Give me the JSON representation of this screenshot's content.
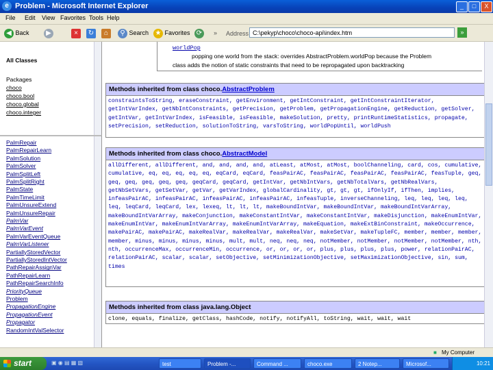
{
  "window": {
    "title": "Problem - Microsoft Internet Explorer",
    "controls": [
      "_",
      "□",
      "X"
    ]
  },
  "menu": [
    "File",
    "Edit",
    "View",
    "Favorites",
    "Tools",
    "Help"
  ],
  "toolbar": {
    "back_label": "Back",
    "search_label": "Search",
    "favorites_label": "Favorites",
    "address_label": "Address",
    "address_value": "C:\\pekyp\\choco\\choco-api\\index.htm",
    "go_label": "»"
  },
  "left_top": {
    "all_classes": "All Classes",
    "packages_label": "Packages",
    "packages": [
      "choco",
      "choco.bool",
      "choco.global",
      "choco.integer"
    ]
  },
  "left_bottom": {
    "classes": [
      {
        "name": "PalmRepair",
        "italic": false
      },
      {
        "name": "PalmRepairLearn",
        "italic": false
      },
      {
        "name": "PalmSolution",
        "italic": false
      },
      {
        "name": "PalmSolver",
        "italic": false
      },
      {
        "name": "PalmSplitLeft",
        "italic": false
      },
      {
        "name": "PalmSplitRight",
        "italic": false
      },
      {
        "name": "PalmState",
        "italic": false
      },
      {
        "name": "PalmTimeLimit",
        "italic": false
      },
      {
        "name": "PalmUnsureExtend",
        "italic": false
      },
      {
        "name": "PalmUnsureRepair",
        "italic": false
      },
      {
        "name": "PalmVar",
        "italic": true
      },
      {
        "name": "PalmVarEvent",
        "italic": true
      },
      {
        "name": "PalmVarEventQueue",
        "italic": false
      },
      {
        "name": "PalmVarListener",
        "italic": true
      },
      {
        "name": "PartiallyStoredVector",
        "italic": false
      },
      {
        "name": "PartiallyStoredIntVector",
        "italic": false
      },
      {
        "name": "PathRepairAssignVar",
        "italic": false
      },
      {
        "name": "PathRepairLearn",
        "italic": false
      },
      {
        "name": "PathRepairSearchInfo",
        "italic": false
      },
      {
        "name": "PriorityQueue",
        "italic": true
      },
      {
        "name": "Problem",
        "italic": false
      },
      {
        "name": "PropagationEngine",
        "italic": true
      },
      {
        "name": "PropagationEvent",
        "italic": true
      },
      {
        "name": "Propagator",
        "italic": true
      },
      {
        "name": "RandomIntValSelector",
        "italic": false
      }
    ]
  },
  "main": {
    "method_summary": {
      "name": "worldPop",
      "desc1": "popping one world from the stack: overrides AbstractProblem.worldPop because the Problem",
      "desc2": "class adds the notion of static constraints that need to be repropagated upon backtracking"
    },
    "sections": [
      {
        "header_prefix": "Methods inherited from class choco.",
        "header_link": "AbstractProblem",
        "body": "constraintsToString, eraseConstraint, getEnvironment, getIntConstraint, getIntConstraintIterator, getIntVarIndex, getNbIntConstraints, getPrecision, getProblem, getPropagationEngine, getReduction, getSolver, getIntVar, getIntVarIndex, isFeasible, isFeasible, makeSolution, pretty, printRuntimeStatistics, propagate, setPrecision, setReduction, solutionToString, varsToString, worldPopUntil, worldPush"
      },
      {
        "header_prefix": "Methods inherited from class choco.",
        "header_link": "AbstractModel",
        "body": "allDifferent, allDifferent, and, and, and, and, atLeast, atMost, atMost, boolChanneling, card, cos, cumulative, cumulative, eq, eq, eq, eq, eq, eqCard, eqCard, feasPairAC, feasPairAC, feasPairAC, feasPairAC, feasTuple, geq, geq, geq, geq, geq, geq, geqCard, geqCard, getIntVar, getNbIntVars, getNbTotalVars, getNbRealVars, getNbSetVars, getSetVar, getVar, getVarIndex, globalCardinality, gt, gt, gt, ifOnlyIf, ifThen, implies, infeasPairAC, infeasPairAC, infeasPairAC, infeasPairAC, infeasTuple, inverseChanneling, leq, leq, leq, leq, leq, leqCard, leqCard, lex, lexeq, lt, lt, lt, makeBoundIntVar, makeBoundIntVar, makeBoundIntVarArray, makeBoundIntVarArray, makeConjunction, makeConstantIntVar, makeConstantIntVar, makeDisjunction, makeEnumIntVar, makeEnumIntVar, makeEnumIntVarArray, makeEnumIntVarArray, makeEquation, makeExtBinConstraint, makeOccurrence, makePairAC, makePairAC, makeRealVar, makeRealVar, makeRealVar, makeSetVar, makeTupleFC, member, member, member, member, minus, minus, minus, minus, mult, mult, neq, neq, neq, notMember, notMember, notMember, notMember, nth, nth, occurrenceMax, occurrenceMin, occurrence, or, or, or, or, plus, plus, plus, plus, power, relationPairAC, relationPairAC, scalar, scalar, setObjective, setMinimizationObjective, setMaximizationObjective, sin, sum, times"
      },
      {
        "header_prefix": "Methods inherited from class java.lang.Object",
        "header_link": "",
        "body": "clone, equals, finalize, getClass, hashCode, notify, notifyAll, toString, wait, wait, wait"
      }
    ]
  },
  "status": {
    "zone": "My Computer"
  },
  "taskbar": {
    "start_label": "start",
    "tasks": [
      "test",
      "Problem -...",
      "Command ...",
      "choco.exe",
      "2 Notep...",
      "Microsof..."
    ],
    "clock": "10:21"
  }
}
